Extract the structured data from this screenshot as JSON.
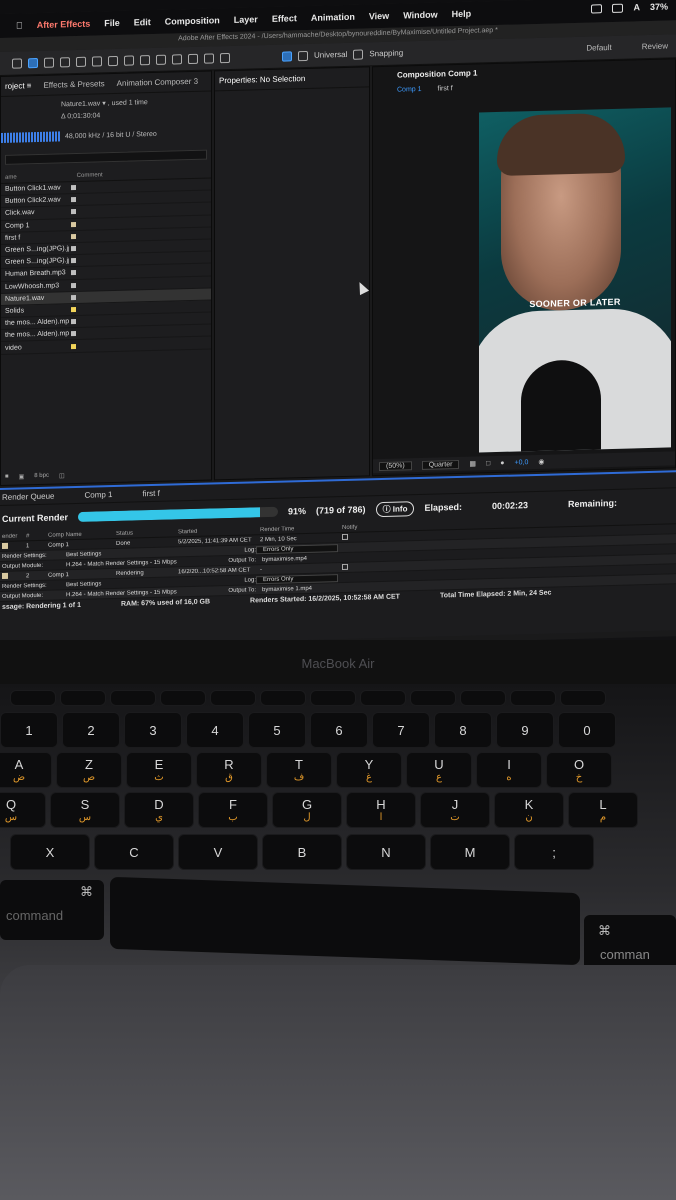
{
  "menubar": {
    "app_name": "After Effects",
    "items": [
      "File",
      "Edit",
      "Composition",
      "Layer",
      "Effect",
      "Animation",
      "View",
      "Window",
      "Help"
    ],
    "battery": "37%",
    "keyboard_input": "A"
  },
  "titlebar": {
    "text": "Adobe After Effects 2024 - /Users/hammache/Desktop/bynoureddine/ByMaximise/Untitled Project.aep *"
  },
  "toolbar": {
    "universal": "Universal",
    "snapping": "Snapping",
    "workspace_default": "Default",
    "workspace_review": "Review"
  },
  "project_panel": {
    "tabs": [
      "roject ≡",
      "Effects & Presets",
      "Animation Composer 3"
    ],
    "selected_item": "Nature1.wav ▾ , used 1 time",
    "duration": "Δ 0;01:30:04",
    "audio_info": "48,000 kHz / 16 bit U / Stereo",
    "col_name": "ame",
    "col_comment": "Comment",
    "items": [
      {
        "name": "Button Click1.wav",
        "color": "#bfbfbf"
      },
      {
        "name": "Button Click2.wav",
        "color": "#bfbfbf"
      },
      {
        "name": "Click.wav",
        "color": "#bfbfbf"
      },
      {
        "name": "Comp 1",
        "color": "#d8c8a0"
      },
      {
        "name": "first f",
        "color": "#d8c8a0"
      },
      {
        "name": "Green S...ing(JPG).jpg",
        "color": "#bfbfbf"
      },
      {
        "name": "Green S...ing(JPG).jpg",
        "color": "#bfbfbf"
      },
      {
        "name": "Human Breath.mp3",
        "color": "#bfbfbf"
      },
      {
        "name": "LowWhoosh.mp3",
        "color": "#bfbfbf"
      },
      {
        "name": "Nature1.wav",
        "color": "#bfbfbf"
      },
      {
        "name": "Solids",
        "color": "#f2d45a"
      },
      {
        "name": "the mos... Alden).mp3",
        "color": "#bfbfbf"
      },
      {
        "name": "the mos... Alden).mp3",
        "color": "#bfbfbf"
      },
      {
        "name": "video",
        "color": "#f2d45a"
      }
    ],
    "bpc": "8 bpc"
  },
  "properties_panel": {
    "title": "Properties: No Selection"
  },
  "composition_panel": {
    "title": "Composition Comp 1",
    "tab_comp": "Comp 1",
    "tab_first": "first f",
    "caption": "SOONER OR LATER",
    "zoom": "(50%)",
    "resolution": "Quarter",
    "exposure": "+0,0"
  },
  "render_queue": {
    "tab": "Render Queue",
    "tab_comp": "Comp 1",
    "tab_first": "first f",
    "current_render": "Current Render",
    "progress": 0.91,
    "percent": "91%",
    "frames": "(719 of 786)",
    "info_button": "Info",
    "elapsed_label": "Elapsed:",
    "elapsed": "00:02:23",
    "remaining_label": "Remaining:",
    "columns": [
      "ender",
      "#",
      "Comp Name",
      "Status",
      "Started",
      "Render Time",
      "Notify"
    ],
    "items": [
      {
        "num": "1",
        "comp": "Comp 1",
        "status": "Done",
        "started": "5/2/2025, 11:41:39 AM CET",
        "time": "2 Min, 10 Sec",
        "render_settings": "Best Settings",
        "output_module": "H.264 - Match Render Settings - 15 Mbps",
        "log": "Errors Only",
        "output_to": "bymaximise.mp4"
      },
      {
        "num": "2",
        "comp": "Comp 1",
        "status": "Rendering",
        "started": "16/2/20...10:52:58 AM CET",
        "time": "-",
        "render_settings": "Best Settings",
        "output_module": "H.264 - Match Render Settings - 15 Mbps",
        "log": "Errors Only",
        "output_to": "bymaximise 1.mp4"
      }
    ],
    "labels": {
      "render_settings": "Render Settings:",
      "output_module": "Output Module:",
      "log": "Log:",
      "output_to": "Output To:"
    },
    "message": "ssage: Rendering 1 of 1",
    "ram": "RAM: 67% used of 16,0 GB",
    "renders_started": "Renders Started: 16/2/2025, 10:52:58 AM CET",
    "total_elapsed": "Total Time Elapsed: 2 Min, 24 Sec"
  },
  "laptop": {
    "brand": "MacBook Air"
  },
  "keyboard": {
    "row_num": [
      "1",
      "2",
      "3",
      "4",
      "5",
      "6",
      "7",
      "8",
      "9",
      "0"
    ],
    "row_a": [
      {
        "en": "A",
        "ar": "ض"
      },
      {
        "en": "Z",
        "ar": "ص"
      },
      {
        "en": "E",
        "ar": "ث"
      },
      {
        "en": "R",
        "ar": "ق"
      },
      {
        "en": "T",
        "ar": "ف"
      },
      {
        "en": "Y",
        "ar": "غ"
      },
      {
        "en": "U",
        "ar": "ع"
      },
      {
        "en": "I",
        "ar": "ه"
      },
      {
        "en": "O",
        "ar": "خ"
      }
    ],
    "row_q": [
      {
        "en": "Q",
        "ar": "س"
      },
      {
        "en": "S",
        "ar": "س"
      },
      {
        "en": "D",
        "ar": "ي"
      },
      {
        "en": "F",
        "ar": "ب"
      },
      {
        "en": "G",
        "ar": "ل"
      },
      {
        "en": "H",
        "ar": "ا"
      },
      {
        "en": "J",
        "ar": "ت"
      },
      {
        "en": "K",
        "ar": "ن"
      },
      {
        "en": "L",
        "ar": "م"
      }
    ],
    "row_w": [
      {
        "en": "X"
      },
      {
        "en": "C"
      },
      {
        "en": "V"
      },
      {
        "en": "B"
      },
      {
        "en": "N"
      },
      {
        "en": "M"
      },
      {
        "en": ";"
      }
    ],
    "command_left": "command",
    "command_right": "comman"
  }
}
